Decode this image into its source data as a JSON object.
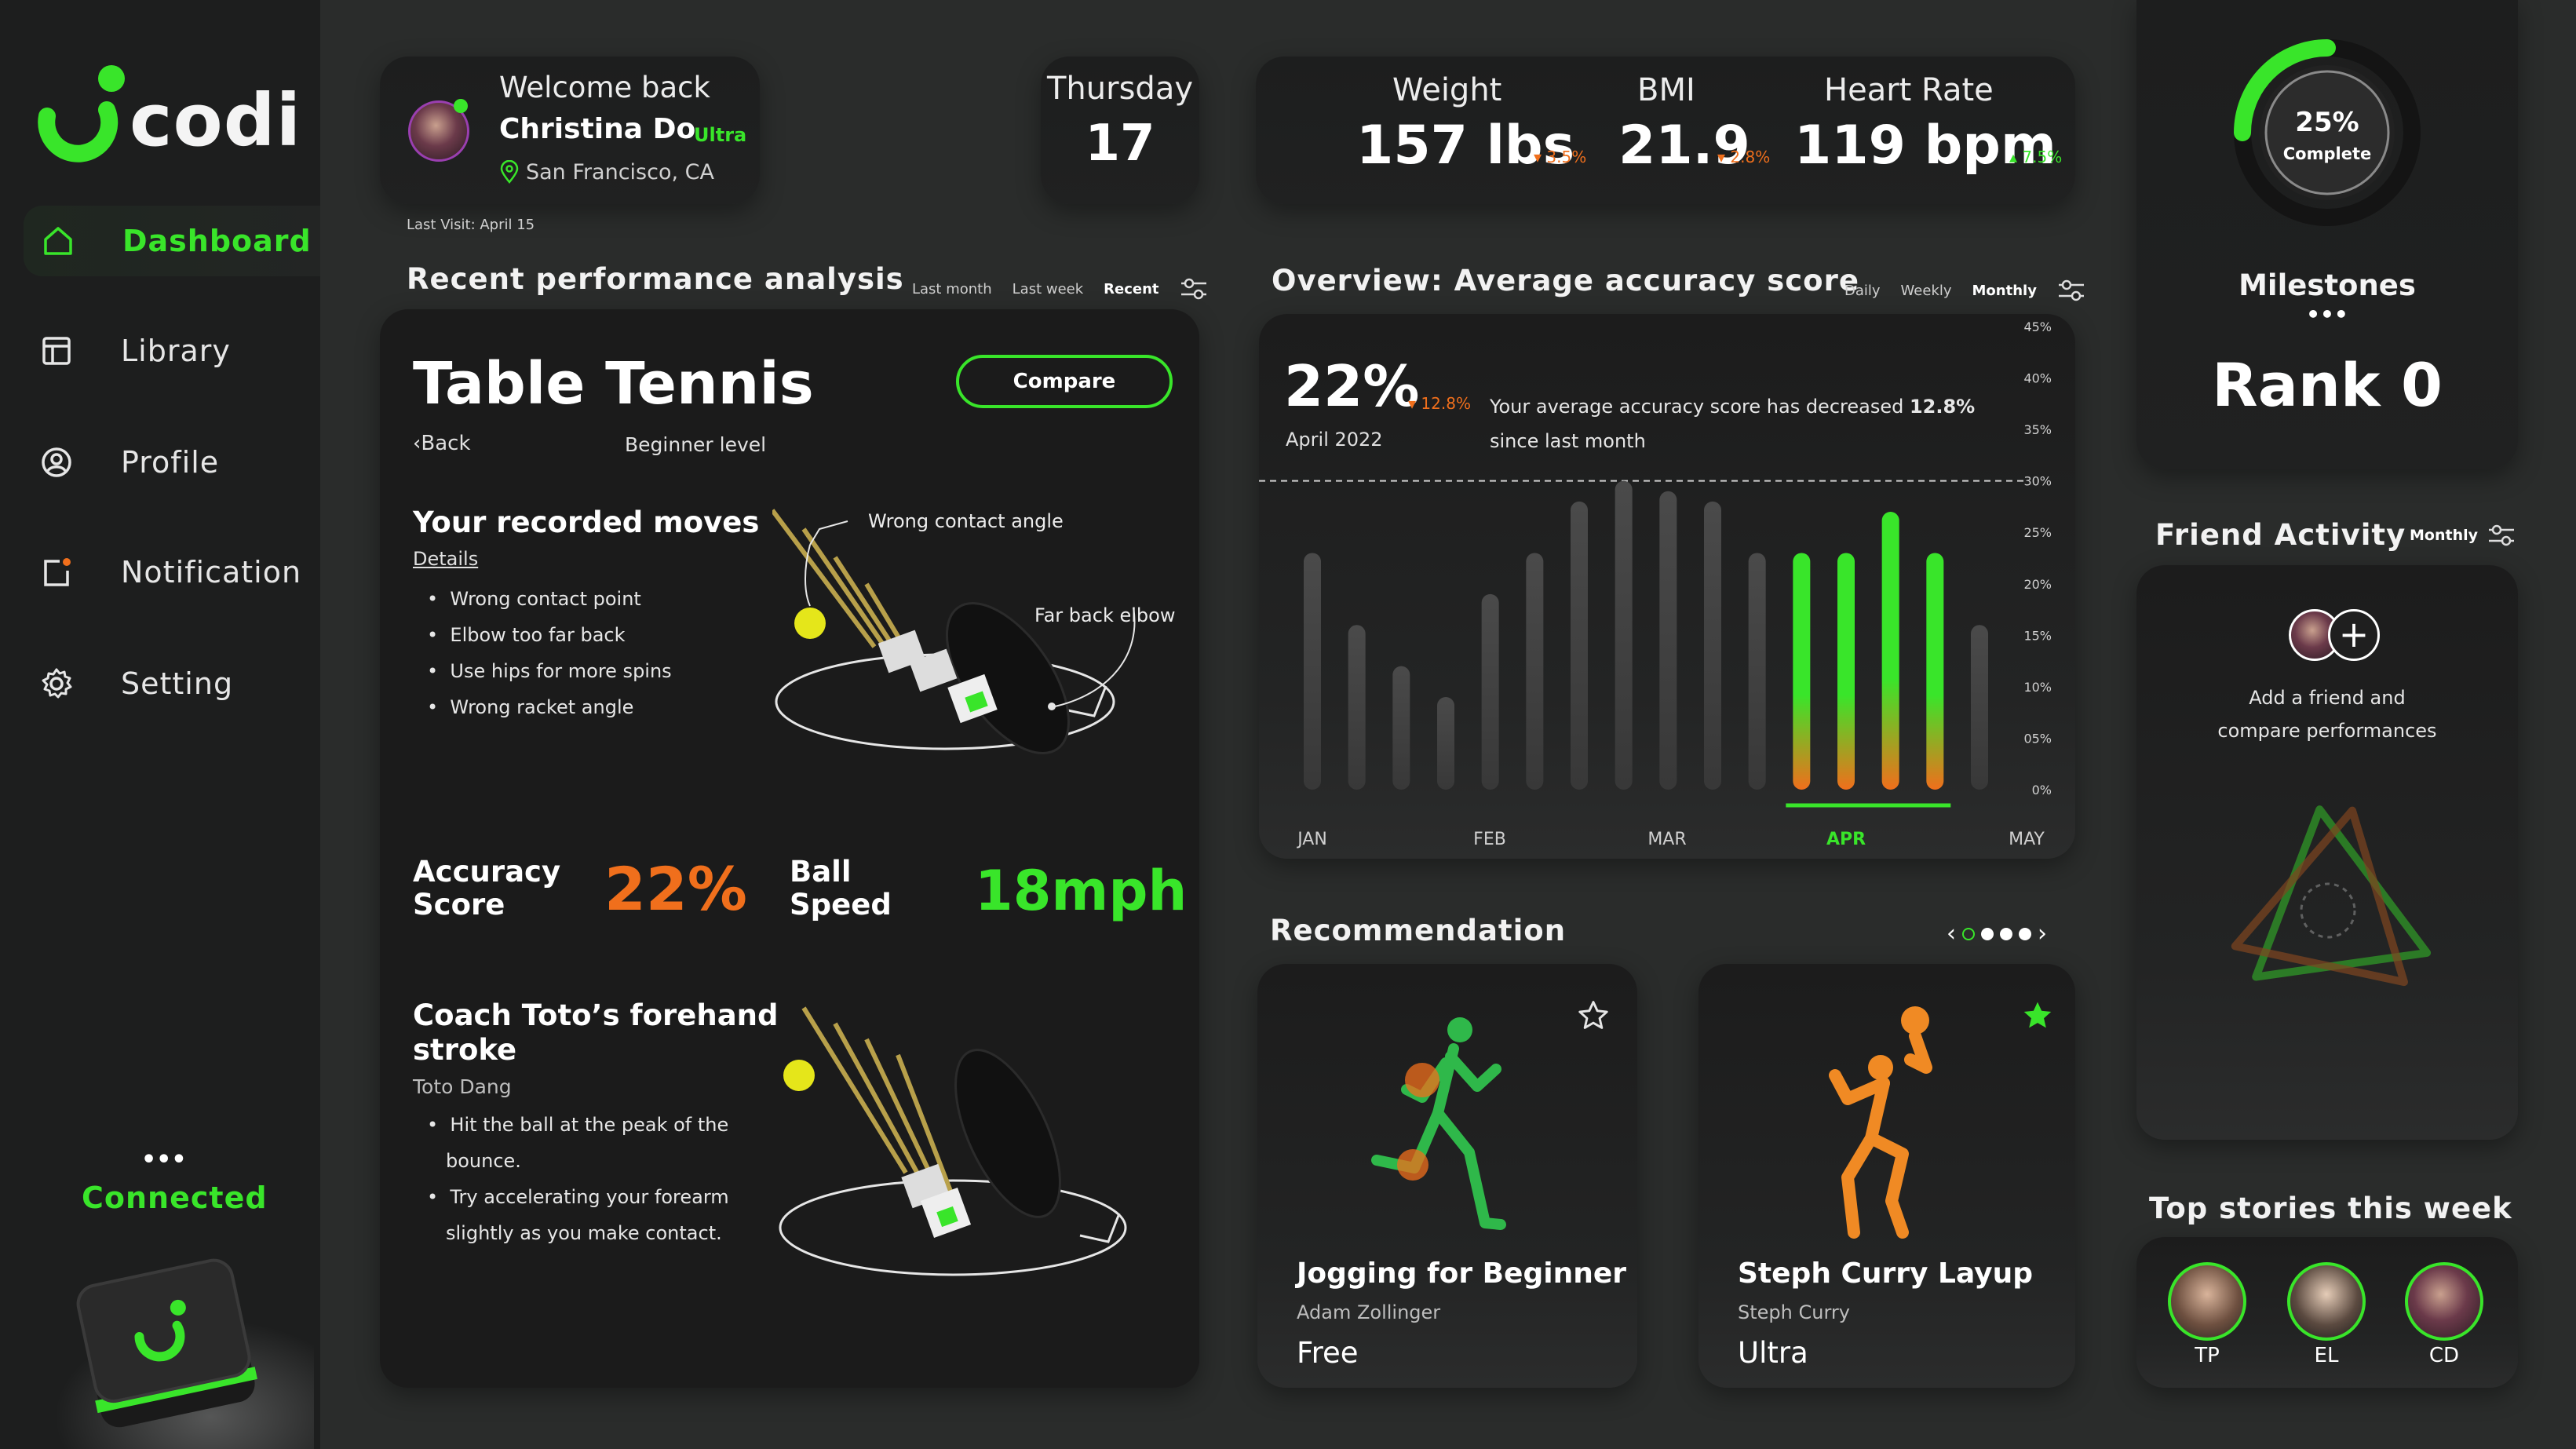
{
  "brand": {
    "name": "codi"
  },
  "sidebar": {
    "items": [
      {
        "label": "Dashboard",
        "icon": "home-icon",
        "active": true
      },
      {
        "label": "Library",
        "icon": "library-icon"
      },
      {
        "label": "Profile",
        "icon": "profile-icon"
      },
      {
        "label": "Notification",
        "icon": "notification-icon"
      },
      {
        "label": "Setting",
        "icon": "settings-icon"
      }
    ],
    "status_dots": "•••",
    "status": "Connected"
  },
  "welcome": {
    "greeting": "Welcome back",
    "name": "Christina Do",
    "tier": "Ultra",
    "location": "San Francisco, CA",
    "last_visit": "Last Visit: April 15"
  },
  "date": {
    "day": "Thursday",
    "number": "17"
  },
  "stats": {
    "weight": {
      "label": "Weight",
      "value": "157 lbs",
      "change": "3.5%"
    },
    "bmi": {
      "label": "BMI",
      "value": "21.9",
      "change": "2.8%"
    },
    "heart": {
      "label": "Heart Rate",
      "value": "119 bpm",
      "change": "7.5%"
    }
  },
  "milestones": {
    "progress_text": "25%",
    "progress_sub": "Complete",
    "progress": 0.25,
    "title": "Milestones",
    "dots": "•••",
    "rank": "Rank 0"
  },
  "performance": {
    "title": "Recent performance analysis",
    "tabs": [
      "Last month",
      "Last week",
      "Recent"
    ],
    "sport": "Table Tennis",
    "compare": "Compare",
    "back": "Back",
    "level": "Beginner level",
    "moves_title": "Your recorded moves",
    "details": "Details",
    "moves": [
      "Wrong contact point",
      "Elbow too far back",
      "Use hips for more spins",
      "Wrong racket angle"
    ],
    "callout_angle": "Wrong contact angle",
    "callout_elbow": "Far back elbow",
    "accuracy_label_1": "Accuracy",
    "accuracy_label_2": "Score",
    "accuracy_value": "22%",
    "speed_label_1": "Ball",
    "speed_label_2": "Speed",
    "speed_value": "18mph",
    "coach_title_1": "Coach Toto’s forehand",
    "coach_title_2": "stroke",
    "coach_name": "Toto Dang",
    "coach_tips_1": [
      "Hit the ball at the peak of the",
      "bounce."
    ],
    "coach_tips_2": [
      "Try accelerating your forearm",
      "slightly as you make contact."
    ]
  },
  "overview": {
    "title": "Overview: Average accuracy score",
    "tabs": [
      "Daily",
      "Weekly",
      "Monthly"
    ],
    "big_value": "22%",
    "delta": "12.8%",
    "date": "April 2022",
    "desc_pre": "Your average accuracy score has decreased ",
    "desc_bold": "12.8%",
    "desc_post": "since last month"
  },
  "chart_data": {
    "type": "bar",
    "title": "Overview: Average accuracy score",
    "months": [
      "JAN",
      "FEB",
      "MAR",
      "APR",
      "MAY"
    ],
    "highlight_month": "APR",
    "yticks": [
      "45%",
      "40%",
      "35%",
      "30%",
      "25%",
      "20%",
      "15%",
      "10%",
      "05%",
      "0%"
    ],
    "ylim": [
      0,
      45
    ],
    "reference_line": 30,
    "values": [
      23,
      16,
      12,
      9,
      19,
      23,
      28,
      30,
      29,
      28,
      23,
      23,
      23,
      27,
      23,
      16
    ],
    "highlighted_bars": [
      11,
      12,
      13,
      14
    ]
  },
  "recommendation": {
    "title": "Recommendation",
    "items": [
      {
        "title": "Jogging for Beginner",
        "author": "Adam Zollinger",
        "price": "Free",
        "starred": false
      },
      {
        "title": "Steph Curry Layup",
        "author": "Steph Curry",
        "price": "Ultra",
        "starred": true
      }
    ]
  },
  "friends": {
    "title": "Friend Activity",
    "filter": "Monthly",
    "add_1": "Add a friend and",
    "add_2": "compare performances"
  },
  "stories": {
    "title": "Top stories this week",
    "people": [
      {
        "initials": "TP"
      },
      {
        "initials": "EL"
      },
      {
        "initials": "CD"
      }
    ]
  },
  "colors": {
    "accent": "#39e52a",
    "warning": "#f06f1c",
    "bg": "#2a2c2b",
    "card": "#1d1e1e"
  }
}
